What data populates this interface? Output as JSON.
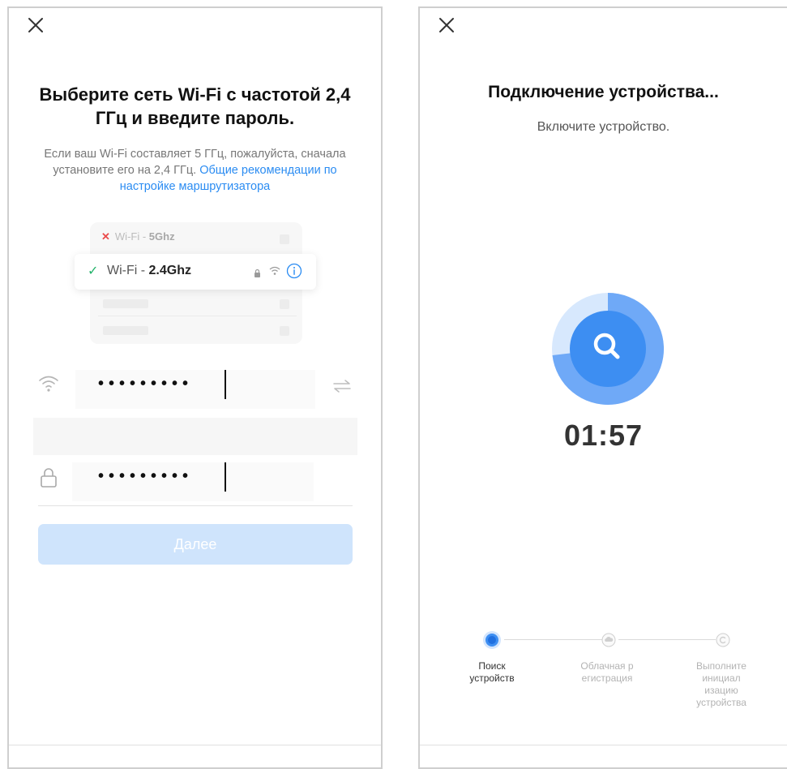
{
  "left": {
    "close_icon": "close-icon",
    "title": "Выберите сеть Wi-Fi с частотой 2,4 ГГц и введите пароль.",
    "description": "Если ваш Wi-Fi составляет 5 ГГц, пожалуйста, сначала установите его на 2,4 ГГц.",
    "link": "Общие рекомендации по настройке маршрутизатора",
    "network_5": {
      "prefix": "Wi-Fi - ",
      "band": "5Ghz"
    },
    "network_24": {
      "prefix": "Wi-Fi - ",
      "band": "2.4Ghz"
    },
    "ssid_value": "•••••••••",
    "password_value": "•••••••••",
    "next_button": "Далее",
    "colors": {
      "accent": "#2b8cf2",
      "button_disabled": "#cfe4fc",
      "check": "#24b36b",
      "cross": "#ea4b4b"
    }
  },
  "right": {
    "close_icon": "close-icon",
    "title": "Подключение устройства...",
    "subtitle": "Включите устройство.",
    "timer": "01:57",
    "steps": [
      {
        "label": "Поиск устройств",
        "state": "active"
      },
      {
        "label": "Облачная р егистрация",
        "state": "inactive"
      },
      {
        "label": "Выполните инициал изацию устройства",
        "state": "inactive"
      }
    ],
    "colors": {
      "primary": "#3d8ef2",
      "ring": "#aed0fa"
    }
  }
}
